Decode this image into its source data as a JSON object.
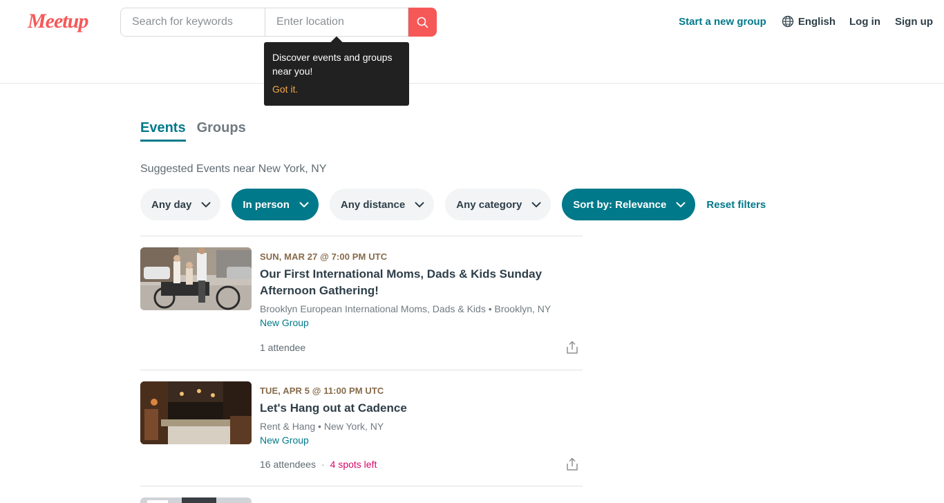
{
  "header": {
    "logo_text": "Meetup",
    "search_keywords_placeholder": "Search for keywords",
    "search_location_placeholder": "Enter location",
    "start_group": "Start a new group",
    "language": "English",
    "login": "Log in",
    "signup": "Sign up"
  },
  "tooltip": {
    "text": "Discover events and groups near you!",
    "dismiss": "Got it."
  },
  "tabs": [
    {
      "label": "Events",
      "active": true
    },
    {
      "label": "Groups",
      "active": false
    }
  ],
  "suggested": "Suggested Events near New York, NY",
  "filters": {
    "day": "Any day",
    "type": "In person",
    "distance": "Any distance",
    "category": "Any category",
    "sort": "Sort by: Relevance",
    "reset": "Reset filters"
  },
  "events": [
    {
      "date": "SUN, MAR 27 @ 7:00 PM UTC",
      "title": "Our First International Moms, Dads & Kids Sunday Afternoon Gathering!",
      "group": "Brooklyn European International Moms, Dads & Kids • Brooklyn, NY",
      "badge": "New Group",
      "attendees": "1 attendee",
      "spots": ""
    },
    {
      "date": "TUE, APR 5 @ 11:00 PM UTC",
      "title": "Let's Hang out at Cadence",
      "group": "Rent & Hang • New York, NY",
      "badge": "New Group",
      "attendees": "16 attendees",
      "spots": "4 spots left"
    }
  ],
  "colors": {
    "brand": "#f65858",
    "teal": "#00798a",
    "date": "#866a49",
    "spots": "#d90768"
  }
}
